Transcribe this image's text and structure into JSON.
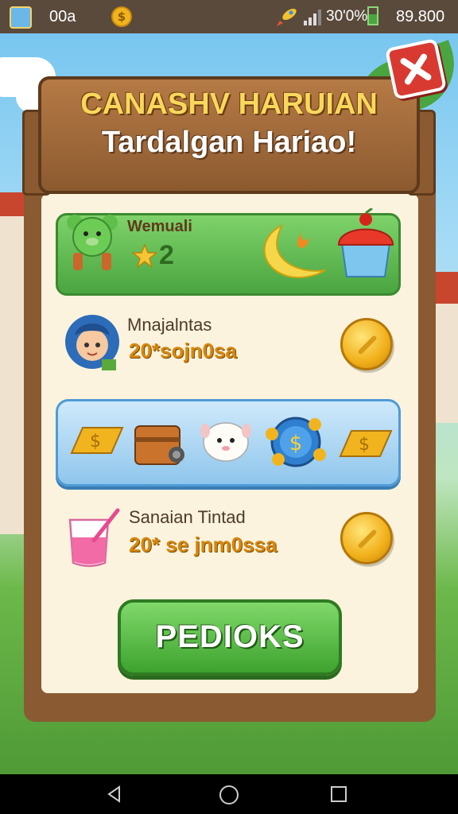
{
  "status_bar": {
    "left_label": "00a",
    "coin_symbol": "$",
    "battery_text": "30'0%",
    "money": "89.800"
  },
  "dialog": {
    "title_line1": "CANASHV HARUIAN",
    "title_line2": "Tardalgan Hariao!",
    "close_icon": "close-x-icon"
  },
  "rewards": {
    "row1": {
      "label": "Wemuali",
      "count": "2",
      "icons": [
        "bear-icon",
        "star-icon",
        "banana-icon",
        "cake-icon"
      ]
    },
    "row2": {
      "name": "Mnajalntas",
      "value": "20*sojn0sa",
      "icons": [
        "girl-avatar-icon",
        "coin-icon"
      ]
    },
    "row3": {
      "icons": [
        "gold-bar-icon",
        "chest-icon",
        "sheep-icon",
        "coin-pile-icon",
        "gold-bar-icon"
      ]
    },
    "row4": {
      "name": "Sanaian Tintad",
      "value": "20* se jnm0ssa",
      "icons": [
        "potion-icon",
        "coin-icon"
      ]
    }
  },
  "collect_button": {
    "label": "PEDIOKS"
  },
  "colors": {
    "wood": "#8a5a32",
    "green": "#4aa540",
    "gold": "#f1b01a",
    "blue": "#8fc6ec",
    "red": "#d83a32"
  }
}
